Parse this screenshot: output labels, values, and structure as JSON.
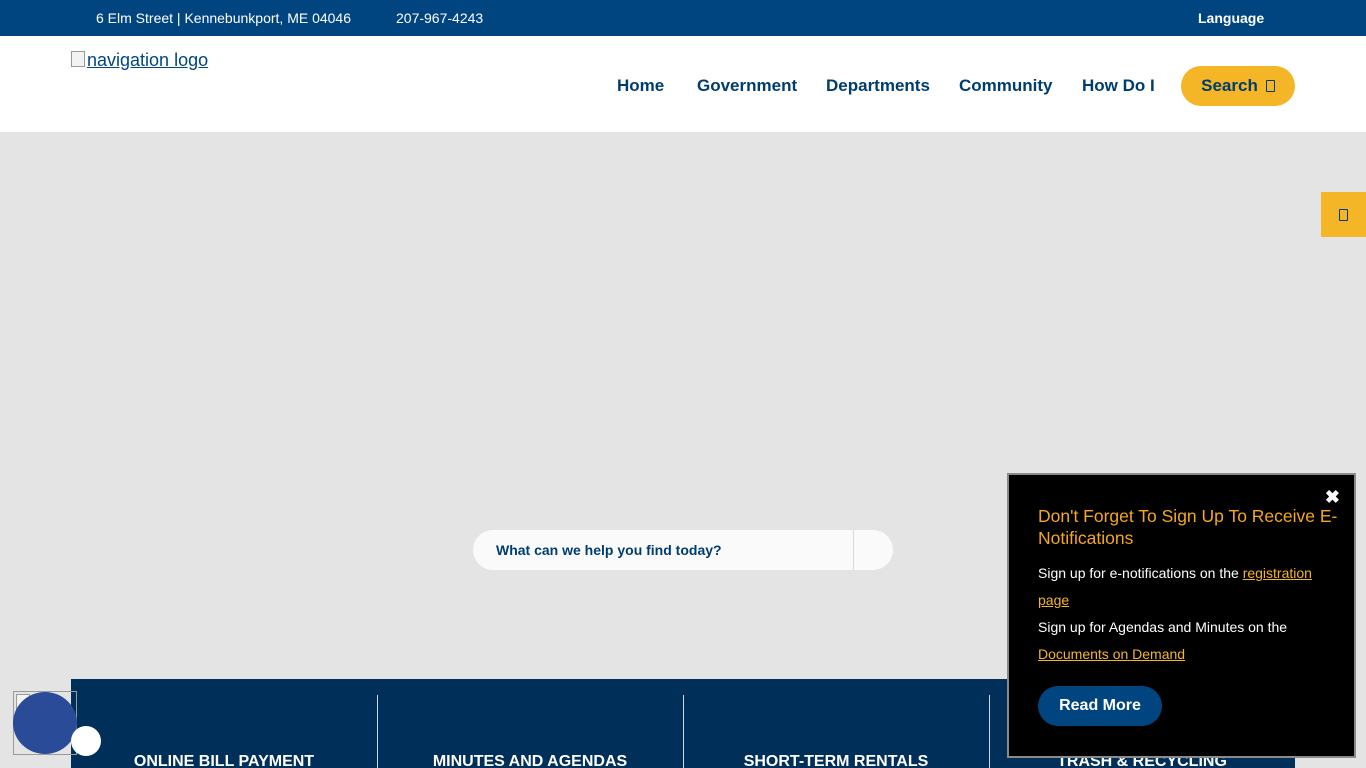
{
  "topbar": {
    "address": "6 Elm Street | Kennebunkport, ME 04046",
    "phone": "207-967-4243",
    "language": "Language"
  },
  "header": {
    "logo_alt": "navigation logo",
    "nav": [
      "Home",
      "Government",
      "Departments",
      "Community",
      "How Do I"
    ],
    "search_label": "Search"
  },
  "hero": {
    "search_placeholder": "What can we help you find today?"
  },
  "quicklinks": [
    "ONLINE BILL PAYMENT",
    "MINUTES AND AGENDAS",
    "SHORT-TERM RENTALS",
    "TRASH & RECYCLING"
  ],
  "popup": {
    "close": "✖",
    "title": "Don't Forget To Sign Up To Receive E-Notifications",
    "line1_text": "Sign up for e-notifications on the ",
    "line1_link": "registration page",
    "line2_text": "Sign up for Agendas and Minutes on the ",
    "line2_link": "Documents on Demand",
    "button": "Read More"
  },
  "colors": {
    "primary_blue": "#004580",
    "dark_navy": "#00305a",
    "accent_yellow": "#f4b526",
    "popup_title_orange": "#f5a623"
  },
  "icons": {
    "search": "search-icon",
    "side_tab": "side-tab-icon",
    "close": "close-icon",
    "accessibility": "accessibility-icon"
  }
}
